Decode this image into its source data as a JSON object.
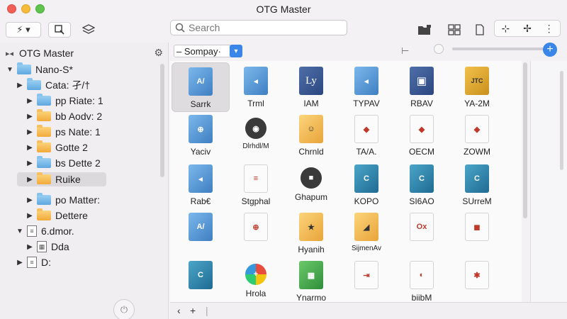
{
  "window": {
    "title": "OTG Master"
  },
  "toolbar": {
    "search_placeholder": "Search",
    "action_glyph": "⚡︎ ▾",
    "segments": [
      "⊹",
      "✢",
      "⋮"
    ]
  },
  "sidebar": {
    "header": "OTG Master",
    "items": [
      {
        "label": "Nano-S*",
        "indent": 0,
        "expanded": true,
        "icon": "folder"
      },
      {
        "label": "Cata: 孑/†",
        "indent": 1,
        "expanded": false,
        "icon": "folder"
      },
      {
        "label": "pp Riate: 1",
        "indent": 2,
        "expanded": false,
        "icon": "folder"
      },
      {
        "label": "bb Aodv: 2",
        "indent": 2,
        "expanded": false,
        "icon": "folder-orange"
      },
      {
        "label": "ps Nate: 1",
        "indent": 2,
        "expanded": false,
        "icon": "folder-orange"
      },
      {
        "label": "Gotte 2",
        "indent": 2,
        "expanded": false,
        "icon": "folder-orange"
      },
      {
        "label": "bs Dette 2",
        "indent": 2,
        "expanded": false,
        "icon": "folder"
      },
      {
        "label": "Ruike",
        "indent": 2,
        "expanded": false,
        "icon": "folder-orange",
        "selected": true
      },
      {
        "label": "po Matter:",
        "indent": 2,
        "expanded": false,
        "icon": "folder"
      },
      {
        "label": "Dettere",
        "indent": 2,
        "expanded": false,
        "icon": "folder-orange"
      },
      {
        "label": "6.dmor.",
        "indent": 1,
        "expanded": true,
        "icon": "doc"
      },
      {
        "label": "Dda",
        "indent": 2,
        "expanded": false,
        "icon": "table"
      },
      {
        "label": "D:",
        "indent": 1,
        "expanded": false,
        "icon": "doc"
      }
    ]
  },
  "content": {
    "filter_select": "– Sompay·",
    "files": [
      {
        "label": "Sarrk",
        "style": "blue",
        "glyph": "A/",
        "selected": true
      },
      {
        "label": "Trml",
        "style": "blue",
        "glyph": "◂"
      },
      {
        "label": "IAM",
        "style": "navy",
        "glyph": "Ly"
      },
      {
        "label": "TYPAV",
        "style": "blue",
        "glyph": "◂"
      },
      {
        "label": "RBAV",
        "style": "navy",
        "glyph": "▣"
      },
      {
        "label": "YA-2M",
        "style": "gold",
        "glyph": "JTC"
      },
      {
        "label": "Yaciv",
        "style": "blue",
        "glyph": "⊕"
      },
      {
        "label": "Dlrhdl/M",
        "style": "dark",
        "glyph": "◉"
      },
      {
        "label": "Chrnld",
        "style": "orange",
        "glyph": "☺"
      },
      {
        "label": "TA/A.",
        "style": "white",
        "glyph": "◆"
      },
      {
        "label": "OECM",
        "style": "white",
        "glyph": "◆"
      },
      {
        "label": "ZOWM",
        "style": "white",
        "glyph": "◆"
      },
      {
        "label": "Rab€",
        "style": "blue",
        "glyph": "◂"
      },
      {
        "label": "Stgphal",
        "style": "white",
        "glyph": "≡"
      },
      {
        "label": "Ghapum",
        "style": "dark",
        "glyph": "■"
      },
      {
        "label": "KOPO",
        "style": "teal",
        "glyph": "C"
      },
      {
        "label": "SI6AO",
        "style": "teal",
        "glyph": "C"
      },
      {
        "label": "SUrreM",
        "style": "teal",
        "glyph": "C"
      },
      {
        "label": "",
        "style": "blue",
        "glyph": "A/"
      },
      {
        "label": "",
        "style": "white",
        "glyph": "⊕"
      },
      {
        "label": "Hyanih",
        "style": "orange",
        "glyph": "★"
      },
      {
        "label": "SijmenAv",
        "style": "orange",
        "glyph": "◢"
      },
      {
        "label": "",
        "style": "white",
        "glyph": "Ox"
      },
      {
        "label": "",
        "style": "white",
        "glyph": "◼"
      },
      {
        "label": "",
        "style": "teal",
        "glyph": "C"
      },
      {
        "label": "Hrola",
        "style": "multi",
        "glyph": "+"
      },
      {
        "label": "Ynarmo",
        "style": "green",
        "glyph": "▦"
      },
      {
        "label": "",
        "style": "white",
        "glyph": "⇥"
      },
      {
        "label": "biibM",
        "style": "white",
        "glyph": "◐"
      },
      {
        "label": "",
        "style": "white",
        "glyph": "✱"
      }
    ],
    "zoom": {
      "fill_fraction": 0.0
    }
  },
  "colors": {
    "accent": "#3a86e8",
    "selection": "#dedcdf"
  }
}
